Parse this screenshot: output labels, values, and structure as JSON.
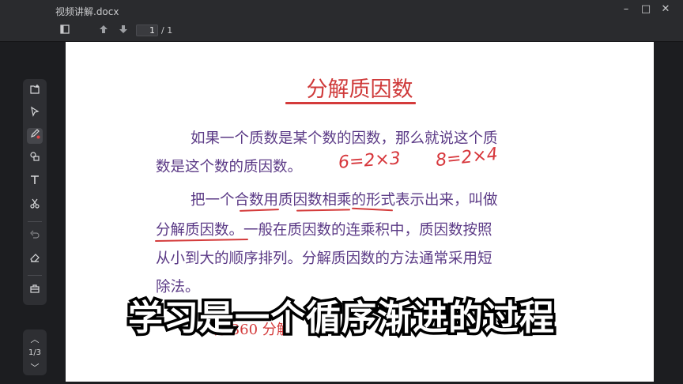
{
  "window": {
    "title": "视频讲解.docx",
    "minimize": "–",
    "maximize": "□",
    "close": "✕"
  },
  "toolbar": {
    "page_current": "1",
    "page_total": "/ 1"
  },
  "sidebar": {
    "icons": [
      "add-page-icon",
      "cursor-icon",
      "pen-icon",
      "shapes-icon",
      "text-icon",
      "scissors-icon",
      "undo-icon",
      "eraser-icon",
      "toolbox-icon"
    ],
    "pager": {
      "up": "︿",
      "label": "1/3",
      "down": "﹀"
    }
  },
  "document": {
    "title": "分解质因数",
    "para1_line1": "如果一个质数是某个数的因数，那么就说这个质",
    "para1_line2": "数是这个数的质因数。",
    "para2_line1": "把一个合数用质因数相乘的形式表示出来，叫做",
    "para2_line2": "分解质因数。一般在质因数的连乘积中，质因数按照",
    "para2_line3": "从小到大的顺序排列。分解质因数的方法通常采用短",
    "para2_line4": "除法。",
    "partial_example": "将 360 分解",
    "annotation1": "6=2×3",
    "annotation2": "8=2×4"
  },
  "subtitle": "学习是一个循序渐进的过程",
  "colors": {
    "title_red": "#cf3a3a",
    "text_purple": "#5b3a86",
    "ink_red": "#d7373c"
  }
}
